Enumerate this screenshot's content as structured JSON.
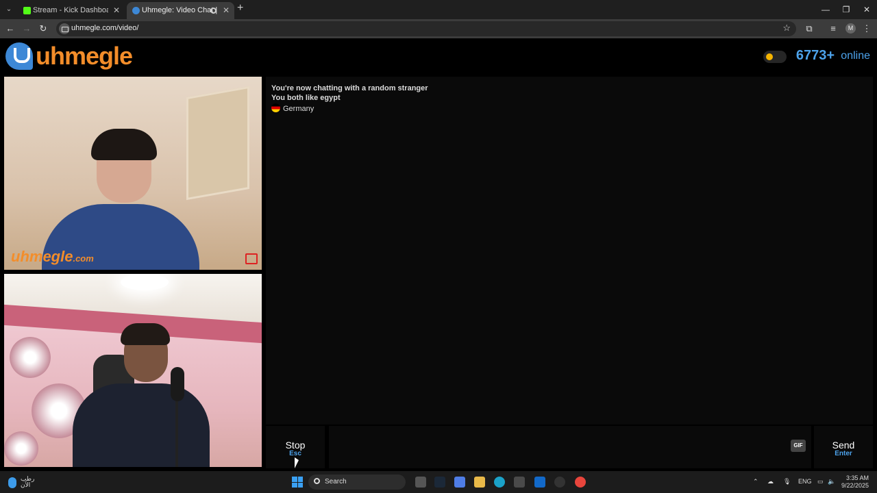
{
  "browser": {
    "tabs": [
      {
        "title": "Stream - Kick Dashboard",
        "active": false
      },
      {
        "title": "Uhmegle: Video Chat | Ome",
        "active": true
      }
    ],
    "url": "uhmegle.com/video/",
    "profile_initial": "M"
  },
  "header": {
    "logo_text": "uhmegle",
    "online_count": "6773+",
    "online_label": "online"
  },
  "video": {
    "watermark": "uhmegle",
    "watermark_suffix": ".com"
  },
  "chat": {
    "messages": [
      "You're now chatting with a random stranger",
      "You both like egypt"
    ],
    "country": "Germany"
  },
  "controls": {
    "stop_label": "Stop",
    "stop_key": "Esc",
    "gif_label": "GIF",
    "send_label": "Send",
    "send_key": "Enter"
  },
  "taskbar": {
    "weather_line1": "رطب",
    "weather_line2": "الآن",
    "search_label": "Search",
    "language": "ENG",
    "time": "3:35 AM",
    "date": "9/22/2025"
  },
  "colors": {
    "brand_orange": "#f38d2a",
    "brand_blue": "#4da3ec"
  }
}
